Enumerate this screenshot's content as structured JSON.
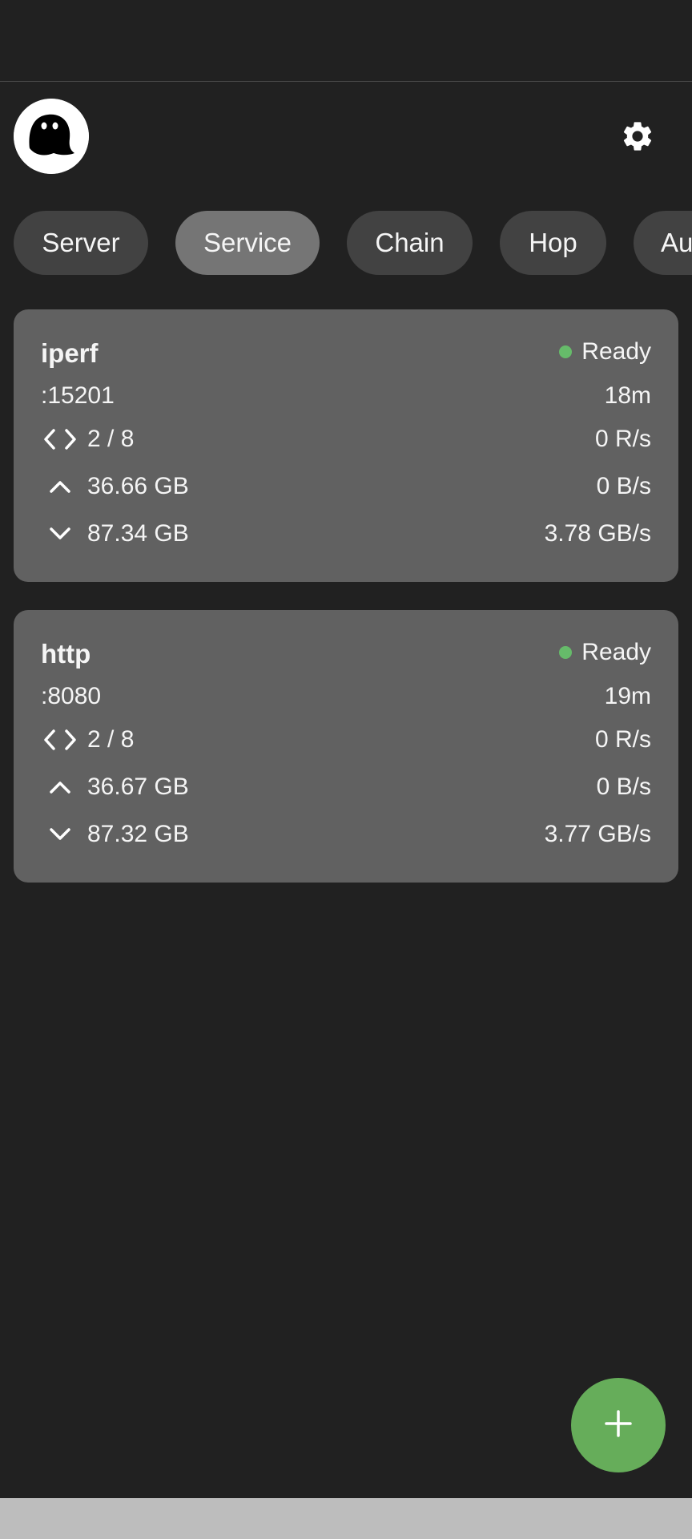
{
  "tabs": [
    {
      "label": "Server",
      "selected": false
    },
    {
      "label": "Service",
      "selected": true
    },
    {
      "label": "Chain",
      "selected": false
    },
    {
      "label": "Hop",
      "selected": false
    },
    {
      "label": "Auth",
      "selected": false
    }
  ],
  "services": [
    {
      "name": "iperf",
      "status": "Ready",
      "address": ":15201",
      "uptime": "18m",
      "connections": "2 / 8",
      "request_rate": "0 R/s",
      "upload_total": "36.66 GB",
      "upload_rate": "0 B/s",
      "download_total": "87.34 GB",
      "download_rate": "3.78 GB/s"
    },
    {
      "name": "http",
      "status": "Ready",
      "address": ":8080",
      "uptime": "19m",
      "connections": "2 / 8",
      "request_rate": "0 R/s",
      "upload_total": "36.67 GB",
      "upload_rate": "0 B/s",
      "download_total": "87.32 GB",
      "download_rate": "3.77 GB/s"
    }
  ],
  "icons": {
    "settings": "gear-icon",
    "connections": "code-icon",
    "upload": "chevron-up-icon",
    "download": "chevron-down-icon",
    "add": "plus-icon"
  },
  "colors": {
    "background": "#212121",
    "card": "#616161",
    "chip": "#424242",
    "chip_selected": "#757575",
    "status_ready": "#66bb6a",
    "fab": "#66ad5a"
  }
}
